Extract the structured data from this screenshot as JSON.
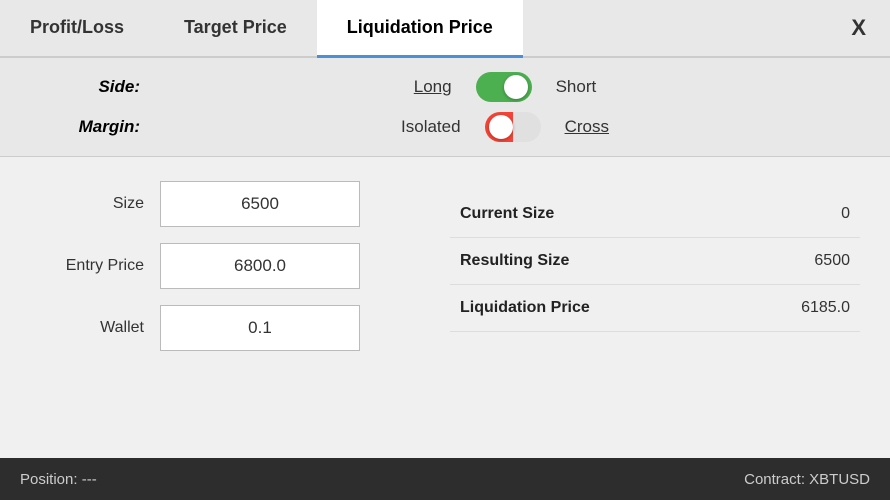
{
  "tabs": [
    {
      "id": "profit-loss",
      "label": "Profit/Loss",
      "active": false
    },
    {
      "id": "target-price",
      "label": "Target Price",
      "active": false
    },
    {
      "id": "liquidation-price",
      "label": "Liquidation Price",
      "active": true
    }
  ],
  "close_button": "X",
  "side": {
    "label": "Side:",
    "option_left": "Long",
    "option_right": "Short",
    "toggle_state": "green"
  },
  "margin": {
    "label": "Margin:",
    "option_left": "Isolated",
    "option_right": "Cross",
    "toggle_state": "red-partial"
  },
  "form": {
    "size_label": "Size",
    "size_value": "6500",
    "entry_price_label": "Entry Price",
    "entry_price_value": "6800.0",
    "wallet_label": "Wallet",
    "wallet_value": "0.1"
  },
  "info_panel": [
    {
      "label": "Current Size",
      "value": "0"
    },
    {
      "label": "Resulting Size",
      "value": "6500"
    },
    {
      "label": "Liquidation Price",
      "value": "6185.0"
    }
  ],
  "footer": {
    "position": "Position: ---",
    "contract": "Contract: XBTUSD"
  }
}
